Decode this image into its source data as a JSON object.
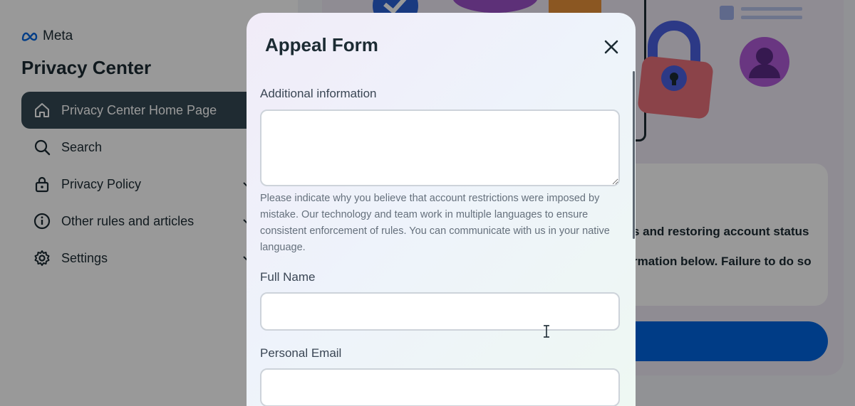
{
  "background": {
    "brand": {
      "name": "Meta",
      "icon": "meta-logo-icon"
    },
    "sidebar": {
      "title": "Privacy Center",
      "items": [
        {
          "label": "Privacy Center Home Page",
          "icon": "home-icon",
          "active": true,
          "expandable": false
        },
        {
          "label": "Search",
          "icon": "search-icon",
          "active": false,
          "expandable": false
        },
        {
          "label": "Privacy Policy",
          "icon": "lock-icon",
          "active": false,
          "expandable": true
        },
        {
          "label": "Other rules and articles",
          "icon": "info-icon",
          "active": false,
          "expandable": true
        },
        {
          "label": "Settings",
          "icon": "gear-icon",
          "active": false,
          "expandable": true
        }
      ]
    },
    "content": {
      "text_line_1": "s and restoring account status",
      "text_line_2": "rmation below. Failure to do so"
    }
  },
  "modal": {
    "title": "Appeal Form",
    "close_icon": "close-icon",
    "fields": {
      "additional_info": {
        "label": "Additional information",
        "value": "",
        "help": "Please indicate why you believe that account restrictions were imposed by mistake. Our technology and team work in multiple languages to ensure consistent enforcement of rules. You can communicate with us in your native language."
      },
      "full_name": {
        "label": "Full Name",
        "value": ""
      },
      "personal_email": {
        "label": "Personal Email",
        "value": ""
      }
    }
  },
  "colors": {
    "active_nav": "#344854",
    "primary_button": "#0064e0",
    "text_dark": "#1c2b33",
    "overlay": "rgba(0,0,0,0.40)"
  }
}
